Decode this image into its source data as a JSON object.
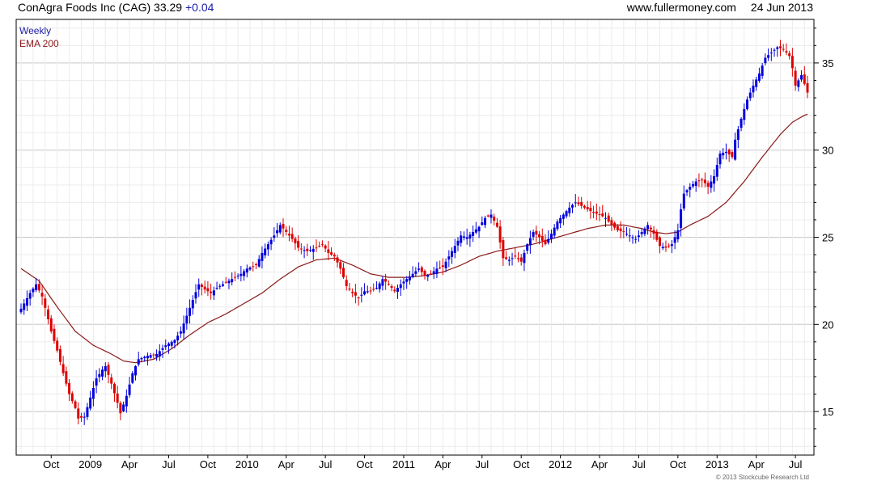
{
  "header": {
    "title": "ConAgra Foods Inc (CAG) 33.29",
    "change": "+0.04",
    "site": "www.fullermoney.com",
    "date": "24 Jun 2013"
  },
  "legend": {
    "weekly": "Weekly",
    "ema": "EMA 200"
  },
  "footer": "© 2013 Stockcube Research Ltd",
  "colors": {
    "up": "#0000dd",
    "down": "#dd0000",
    "ema": "#8b1a1a",
    "grid_major": "#c8c8c8",
    "grid_minor": "#ececec",
    "weekly_label": "#1a1aa8",
    "ema_label": "#8b1a1a"
  },
  "chart_data": {
    "type": "candlestick",
    "frequency": "weekly",
    "ylim": [
      12.5,
      37.5
    ],
    "y_ticks": [
      15,
      20,
      25,
      30,
      35
    ],
    "y_axis_side": "right",
    "x_ticks": [
      "Oct",
      "2009",
      "Apr",
      "Jul",
      "Oct",
      "2010",
      "Apr",
      "Jul",
      "Oct",
      "2011",
      "Apr",
      "Jul",
      "Oct",
      "2012",
      "Apr",
      "Jul",
      "Oct",
      "2013",
      "Apr",
      "Jul"
    ],
    "x_tick_weeks": [
      10,
      23,
      36,
      49,
      62,
      75,
      88,
      101,
      114,
      127,
      140,
      153,
      166,
      179,
      192,
      205,
      218,
      231,
      244,
      257
    ],
    "weeks_total": 262,
    "close_path": [
      [
        0,
        20.9
      ],
      [
        3,
        21.8
      ],
      [
        5,
        22.3
      ],
      [
        7,
        21.6
      ],
      [
        9,
        20.3
      ],
      [
        10,
        19.6
      ],
      [
        12,
        18.5
      ],
      [
        14,
        17.2
      ],
      [
        16,
        16.0
      ],
      [
        18,
        15.2
      ],
      [
        19,
        14.6
      ],
      [
        21,
        14.7
      ],
      [
        23,
        15.8
      ],
      [
        25,
        16.9
      ],
      [
        27,
        17.4
      ],
      [
        28,
        17.6
      ],
      [
        30,
        16.6
      ],
      [
        32,
        15.5
      ],
      [
        33,
        14.9
      ],
      [
        35,
        15.9
      ],
      [
        37,
        17.2
      ],
      [
        39,
        18.0
      ],
      [
        42,
        18.2
      ],
      [
        45,
        18.3
      ],
      [
        48,
        18.8
      ],
      [
        51,
        19.1
      ],
      [
        53,
        19.6
      ],
      [
        55,
        20.5
      ],
      [
        57,
        21.4
      ],
      [
        59,
        22.3
      ],
      [
        61,
        22.0
      ],
      [
        63,
        21.8
      ],
      [
        65,
        22.1
      ],
      [
        67,
        22.3
      ],
      [
        70,
        22.6
      ],
      [
        73,
        22.9
      ],
      [
        75,
        23.2
      ],
      [
        78,
        23.4
      ],
      [
        80,
        24.1
      ],
      [
        82,
        24.6
      ],
      [
        84,
        25.1
      ],
      [
        86,
        25.7
      ],
      [
        88,
        25.3
      ],
      [
        90,
        24.9
      ],
      [
        92,
        24.4
      ],
      [
        95,
        24.2
      ],
      [
        98,
        24.4
      ],
      [
        100,
        24.6
      ],
      [
        102,
        24.1
      ],
      [
        104,
        23.9
      ],
      [
        106,
        23.2
      ],
      [
        108,
        22.2
      ],
      [
        110,
        21.8
      ],
      [
        112,
        21.5
      ],
      [
        114,
        21.9
      ],
      [
        116,
        21.9
      ],
      [
        118,
        22.1
      ],
      [
        120,
        22.6
      ],
      [
        122,
        22.3
      ],
      [
        124,
        21.9
      ],
      [
        126,
        22.3
      ],
      [
        128,
        22.6
      ],
      [
        130,
        22.9
      ],
      [
        132,
        23.2
      ],
      [
        134,
        22.8
      ],
      [
        136,
        22.9
      ],
      [
        138,
        23.2
      ],
      [
        140,
        23.3
      ],
      [
        142,
        23.9
      ],
      [
        144,
        24.5
      ],
      [
        146,
        25.1
      ],
      [
        148,
        25.0
      ],
      [
        150,
        25.3
      ],
      [
        152,
        25.6
      ],
      [
        154,
        26.1
      ],
      [
        156,
        26.3
      ],
      [
        158,
        25.6
      ],
      [
        160,
        23.8
      ],
      [
        162,
        23.7
      ],
      [
        164,
        23.9
      ],
      [
        166,
        23.6
      ],
      [
        168,
        24.6
      ],
      [
        170,
        25.3
      ],
      [
        172,
        25.0
      ],
      [
        174,
        24.6
      ],
      [
        176,
        25.2
      ],
      [
        178,
        25.9
      ],
      [
        180,
        26.3
      ],
      [
        182,
        26.7
      ],
      [
        184,
        27.0
      ],
      [
        186,
        26.8
      ],
      [
        188,
        26.6
      ],
      [
        190,
        26.4
      ],
      [
        192,
        26.3
      ],
      [
        194,
        26.1
      ],
      [
        196,
        25.7
      ],
      [
        198,
        25.4
      ],
      [
        200,
        25.3
      ],
      [
        202,
        25.1
      ],
      [
        204,
        24.9
      ],
      [
        206,
        25.3
      ],
      [
        208,
        25.7
      ],
      [
        210,
        25.2
      ],
      [
        212,
        24.5
      ],
      [
        214,
        24.4
      ],
      [
        216,
        24.6
      ],
      [
        218,
        25.4
      ],
      [
        219,
        26.6
      ],
      [
        220,
        27.5
      ],
      [
        222,
        27.9
      ],
      [
        224,
        28.2
      ],
      [
        226,
        28.3
      ],
      [
        228,
        27.9
      ],
      [
        230,
        28.5
      ],
      [
        232,
        29.8
      ],
      [
        234,
        29.9
      ],
      [
        236,
        29.6
      ],
      [
        237,
        30.6
      ],
      [
        239,
        31.8
      ],
      [
        241,
        32.9
      ],
      [
        243,
        33.7
      ],
      [
        245,
        34.4
      ],
      [
        247,
        35.3
      ],
      [
        249,
        35.6
      ],
      [
        251,
        35.9
      ],
      [
        253,
        35.8
      ],
      [
        255,
        35.4
      ],
      [
        256,
        34.7
      ],
      [
        257,
        33.7
      ],
      [
        259,
        34.3
      ],
      [
        261,
        33.3
      ]
    ],
    "ema_path": [
      [
        0,
        23.2
      ],
      [
        6,
        22.5
      ],
      [
        12,
        21.0
      ],
      [
        18,
        19.6
      ],
      [
        24,
        18.8
      ],
      [
        30,
        18.3
      ],
      [
        34,
        17.9
      ],
      [
        38,
        17.8
      ],
      [
        44,
        18.0
      ],
      [
        50,
        18.6
      ],
      [
        56,
        19.4
      ],
      [
        62,
        20.1
      ],
      [
        68,
        20.6
      ],
      [
        74,
        21.2
      ],
      [
        80,
        21.8
      ],
      [
        86,
        22.6
      ],
      [
        92,
        23.3
      ],
      [
        98,
        23.7
      ],
      [
        104,
        23.8
      ],
      [
        110,
        23.4
      ],
      [
        116,
        22.9
      ],
      [
        122,
        22.7
      ],
      [
        128,
        22.7
      ],
      [
        134,
        22.8
      ],
      [
        140,
        23.0
      ],
      [
        146,
        23.4
      ],
      [
        152,
        23.9
      ],
      [
        158,
        24.2
      ],
      [
        164,
        24.4
      ],
      [
        170,
        24.6
      ],
      [
        176,
        24.9
      ],
      [
        182,
        25.2
      ],
      [
        188,
        25.5
      ],
      [
        194,
        25.7
      ],
      [
        200,
        25.7
      ],
      [
        206,
        25.5
      ],
      [
        210,
        25.3
      ],
      [
        214,
        25.2
      ],
      [
        218,
        25.3
      ],
      [
        222,
        25.7
      ],
      [
        228,
        26.2
      ],
      [
        234,
        27.0
      ],
      [
        240,
        28.2
      ],
      [
        246,
        29.6
      ],
      [
        252,
        30.9
      ],
      [
        256,
        31.6
      ],
      [
        260,
        32.0
      ],
      [
        262,
        32.1
      ]
    ],
    "last_close": 33.29,
    "change": 0.04
  }
}
